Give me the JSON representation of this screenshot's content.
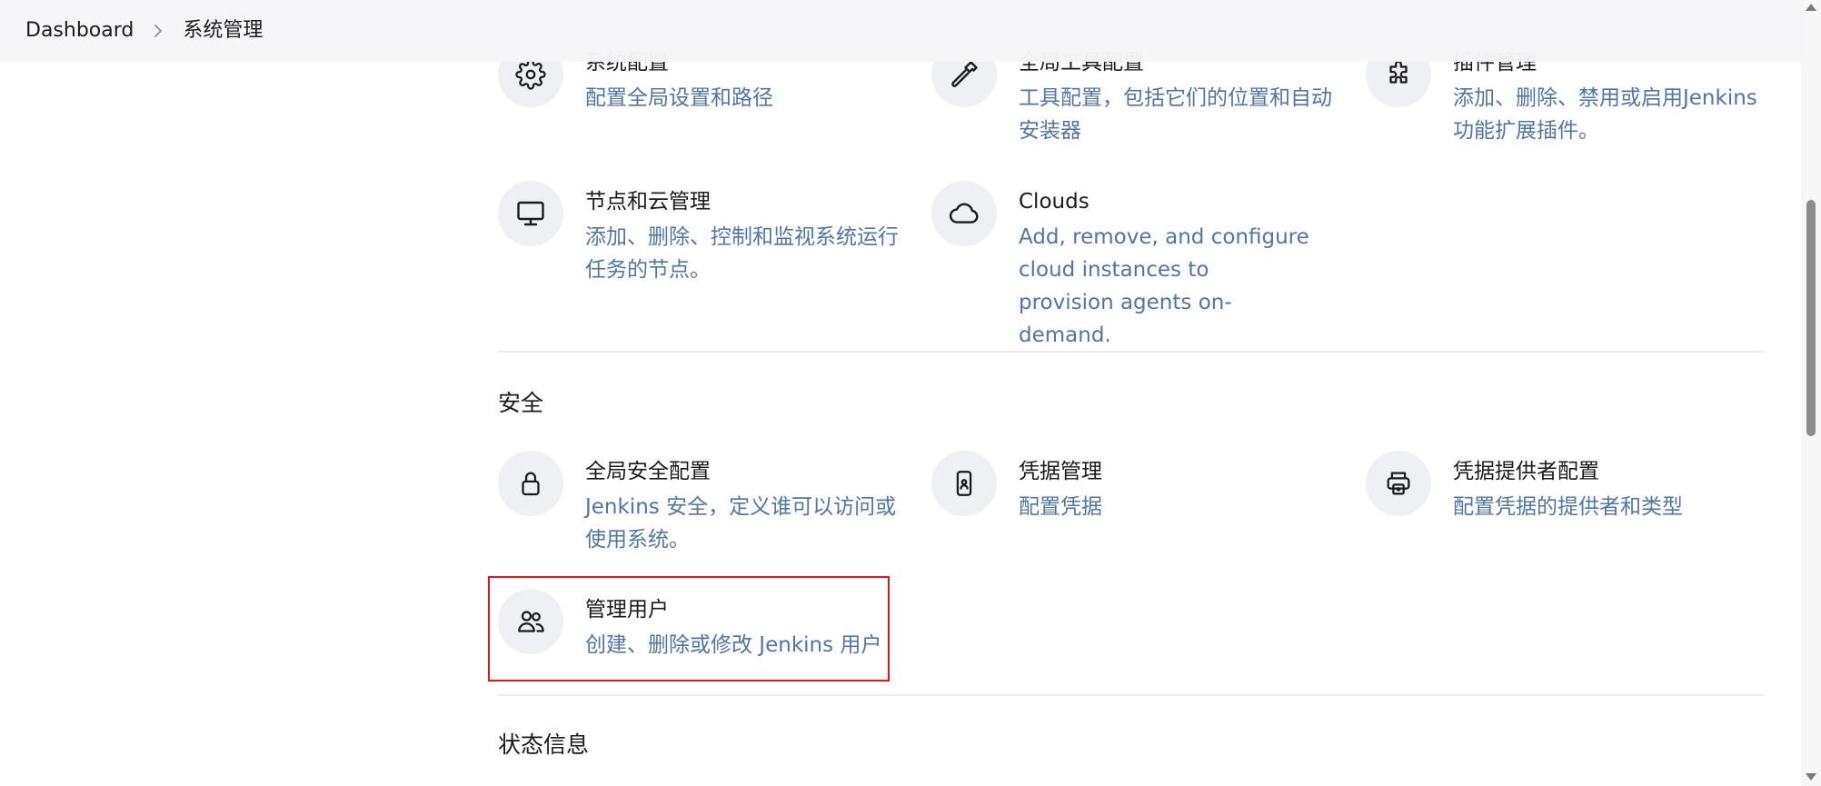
{
  "breadcrumb": {
    "items": [
      "Dashboard",
      "系统管理"
    ]
  },
  "system_config": {
    "cards": [
      {
        "title": "系统配置",
        "desc": "配置全局设置和路径",
        "icon": "gear-icon"
      },
      {
        "title": "全局工具配置",
        "desc": "工具配置，包括它们的位置和自动安装器",
        "icon": "hammer-icon"
      },
      {
        "title": "插件管理",
        "desc": "添加、删除、禁用或启用Jenkins功能扩展插件。",
        "icon": "puzzle-icon"
      },
      {
        "title": "节点和云管理",
        "desc": "添加、删除、控制和监视系统运行任务的节点。",
        "icon": "monitor-icon"
      },
      {
        "title": "Clouds",
        "desc": "Add, remove, and configure cloud instances to provision agents on-demand.",
        "icon": "cloud-icon"
      }
    ]
  },
  "security": {
    "heading": "安全",
    "cards": [
      {
        "title": "全局安全配置",
        "desc": "Jenkins 安全，定义谁可以访问或使用系统。",
        "icon": "lock-icon"
      },
      {
        "title": "凭据管理",
        "desc": "配置凭据",
        "icon": "phone-id-icon"
      },
      {
        "title": "凭据提供者配置",
        "desc": "配置凭据的提供者和类型",
        "icon": "printer-icon"
      },
      {
        "title": "管理用户",
        "desc": "创建、删除或修改 Jenkins 用户",
        "icon": "users-icon"
      }
    ]
  },
  "status": {
    "heading": "状态信息"
  },
  "colors": {
    "accent_text": "#53759e",
    "icon_bg": "#eff0f4",
    "highlight_border": "#e0141e"
  }
}
